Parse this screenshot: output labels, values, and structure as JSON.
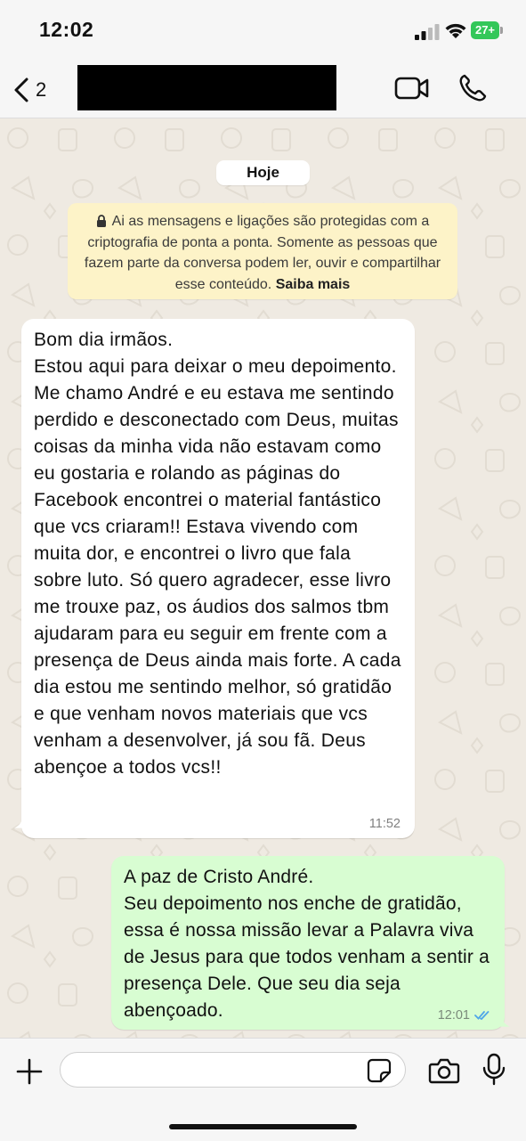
{
  "status_bar": {
    "time": "12:02",
    "battery": "27+"
  },
  "header": {
    "back_count": "2",
    "contact_name": "[redacted]"
  },
  "chat": {
    "date_chip": "Hoje",
    "notice": {
      "text": "Ai as mensagens e ligações são protegidas com a criptografia de ponta a ponta. Somente as pessoas que fazem parte da conversa podem ler, ouvir e compartilhar esse conteúdo.",
      "link": "Saiba mais"
    },
    "messages": [
      {
        "direction": "in",
        "text": "Bom dia irmãos.\nEstou aqui para deixar o meu depoimento. Me chamo André e eu estava me sentindo perdido e desconectado com Deus, muitas coisas da minha vida não estavam como eu gostaria e rolando as páginas do Facebook encontrei o material fantástico que vcs criaram!! Estava vivendo com muita dor, e encontrei o livro que fala sobre luto. Só quero agradecer, esse livro me trouxe paz, os áudios dos salmos tbm ajudaram para eu seguir em frente com a presença de Deus ainda mais forte. A cada dia estou me sentindo melhor, só gratidão e que venham novos materiais que vcs venham a desenvolver, já sou fã. Deus abençoe a todos vcs!!",
        "time": "11:52"
      },
      {
        "direction": "out",
        "text": "A paz de Cristo André.\nSeu depoimento nos enche de gratidão, essa é nossa missão levar a Palavra viva de Jesus para que todos venham a sentir a presença Dele. Que seu dia seja abençoado.",
        "time": "12:01"
      }
    ]
  },
  "composer": {
    "input_value": ""
  },
  "colors": {
    "incoming_bubble": "#ffffff",
    "outgoing_bubble": "#d8fdd2",
    "notice_bg": "#fdf3c8",
    "read_receipt": "#4fa6e8",
    "battery": "#33c759"
  }
}
